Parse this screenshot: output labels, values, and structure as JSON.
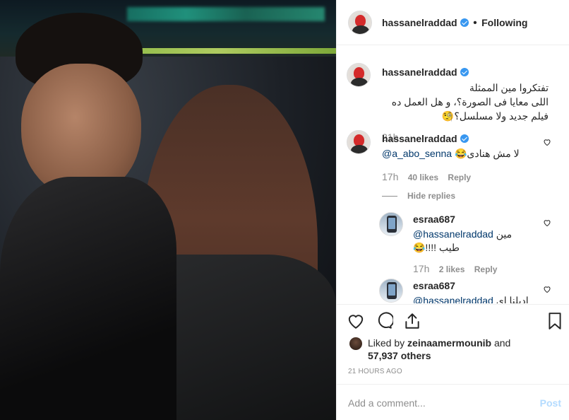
{
  "header": {
    "username": "hassanelraddad",
    "separator": "•",
    "follow_label": "Following"
  },
  "caption": {
    "username": "hassanelraddad",
    "line1": "تفتكروا مين الممثلة",
    "line2": "اللى معايا فى الصورة؟، و هل العمل ده",
    "line3": "فيلم جديد ولا مسلسل؟🧐",
    "time": "21h"
  },
  "comments": [
    {
      "username": "hassanelraddad",
      "mention": "@a_abo_senna",
      "text": "لا مش هنادى😂",
      "time": "17h",
      "likes": "40 likes",
      "reply": "Reply",
      "hide_replies": "Hide replies"
    },
    {
      "username": "esraa687",
      "mention": "@hassanelraddad",
      "text": "مين",
      "text2": "طيب !!!!😂",
      "time": "17h",
      "likes": "2 likes",
      "reply": "Reply"
    },
    {
      "username": "esraa687",
      "mention": "@hassanelraddad",
      "text": "اديلنا اى"
    }
  ],
  "likes": {
    "prefix": "Liked by",
    "user": "zeinaamermounib",
    "and": "and",
    "count": "57,937 others"
  },
  "timestamp": "21 HOURS AGO",
  "add_comment": {
    "placeholder": "Add a comment...",
    "post_label": "Post"
  },
  "icons": [
    "heart-icon",
    "comment-icon",
    "share-icon",
    "bookmark-icon",
    "verified-icon"
  ],
  "colors": {
    "verified": "#3897f0",
    "mention": "#00376b",
    "post_disabled": "#b3dbff"
  }
}
